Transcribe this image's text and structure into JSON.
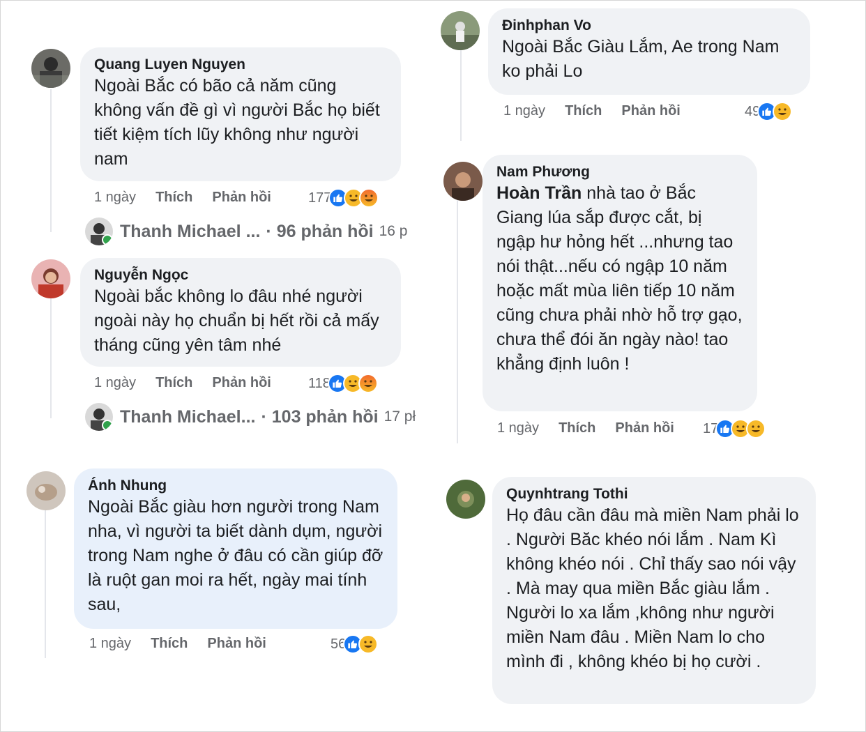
{
  "left_column": {
    "comment1": {
      "author": "Quang Luyen Nguyen",
      "text": "Ngoài Bắc có bão cả năm cũng không vấn đề gì vì người Bắc họ biết tiết kiệm tích lũy không như người nam",
      "time": "1 ngày",
      "like_label": "Thích",
      "reply_label": "Phản hồi",
      "reaction_count": "177",
      "reactions": [
        "like-icon",
        "haha-icon",
        "angry-icon"
      ]
    },
    "reply1": {
      "author": "Thanh Michael ...",
      "summary": "· 96 phản hồi",
      "time": "16 p"
    },
    "comment2": {
      "author": "Nguyễn Ngọc",
      "text": "Ngoài bắc không lo đâu nhé người ngoài này họ chuẩn bị hết rồi cả mấy tháng cũng yên tâm nhé",
      "time": "1 ngày",
      "like_label": "Thích",
      "reply_label": "Phản hồi",
      "reaction_count": "118",
      "reactions": [
        "like-icon",
        "haha-icon",
        "angry-icon"
      ]
    },
    "reply2": {
      "author": "Thanh Michael...",
      "summary": "· 103 phản hồi",
      "time": "17 pł"
    },
    "comment3": {
      "author": "Ánh Nhung",
      "text": "Ngoài Bắc giàu hơn người trong Nam nha, vì người ta biết dành dụm, người trong Nam nghe ở đâu có cần giúp đỡ là ruột gan moi ra hết, ngày mai tính sau,",
      "time": "1 ngày",
      "like_label": "Thích",
      "reply_label": "Phản hồi",
      "reaction_count": "56",
      "reactions": [
        "like-icon",
        "haha-icon"
      ]
    }
  },
  "right_column": {
    "comment1": {
      "author": "Đinhphan Vo",
      "text": "Ngoài Bắc Giàu Lắm, Ae trong Nam ko phải Lo",
      "time": "1 ngày",
      "like_label": "Thích",
      "reply_label": "Phản hồi",
      "reaction_count": "49",
      "reactions": [
        "like-icon",
        "haha-icon"
      ]
    },
    "comment2": {
      "author": "Nam Phương",
      "mention": "Hoàn Trần",
      "text": " nhà tao ở Bắc Giang lúa sắp được cắt, bị ngập hư hỏng hết ...nhưng tao nói thật...nếu có ngập 10 năm hoặc mất mùa liên tiếp 10 năm cũng chưa phải nhờ hỗ trợ gạo, chưa thể đói ăn ngày nào! tao khẳng định luôn !",
      "time": "1 ngày",
      "like_label": "Thích",
      "reply_label": "Phản hồi",
      "reaction_count": "17",
      "reactions": [
        "like-icon",
        "haha-icon",
        "care-icon"
      ]
    },
    "comment3": {
      "author": "Quynhtrang Tothi",
      "text": "Họ đâu cần đâu mà miền Nam phải lo . Người Băc khéo nói lắm . Nam Kì không khéo nói . Chỉ thấy sao nói vậy . Mà may qua miền Bắc giàu lắm . Người lo xa lắm ,không như người miền Nam đâu . Miền Nam lo cho mình đi , không khéo bị họ cười ."
    }
  },
  "colors": {
    "bubble": "#f0f2f5",
    "bubble_highlight": "#e8f0fb",
    "meta_text": "#65676b",
    "like_blue": "#1877f2",
    "online_green": "#31a24c"
  }
}
